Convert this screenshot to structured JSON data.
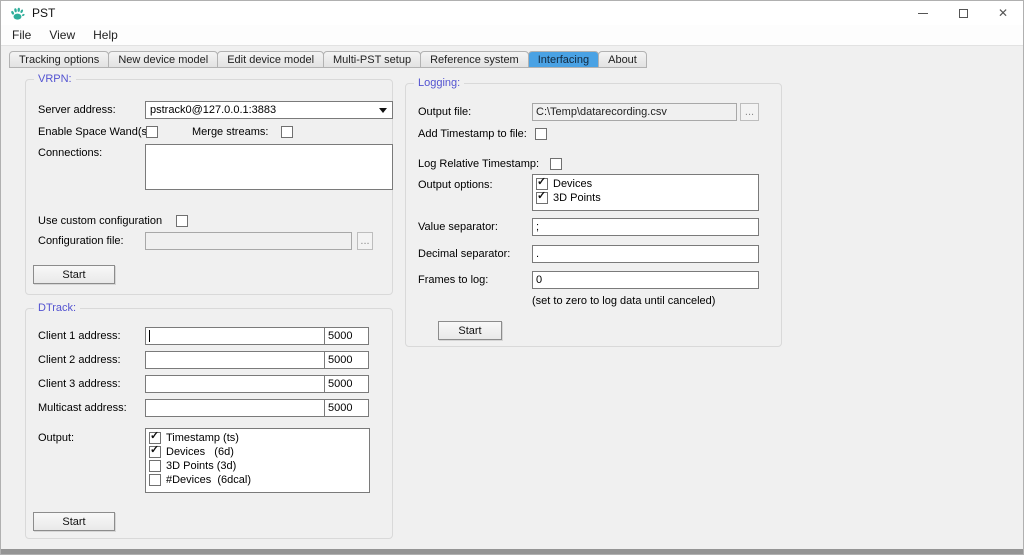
{
  "window": {
    "title": "PST",
    "controls": {
      "minimize": "minimize",
      "maximize": "maximize",
      "close": "close"
    }
  },
  "colors": {
    "tab_selected": "#4aa2e4",
    "group_title": "#5353d1",
    "app_icon_teal": "#2fae9b"
  },
  "menu": {
    "items": [
      "File",
      "View",
      "Help"
    ]
  },
  "tabs": [
    {
      "label": "Tracking options",
      "selected": false
    },
    {
      "label": "New device model",
      "selected": false
    },
    {
      "label": "Edit device model",
      "selected": false
    },
    {
      "label": "Multi-PST setup",
      "selected": false
    },
    {
      "label": "Reference system",
      "selected": false
    },
    {
      "label": "Interfacing",
      "selected": true
    },
    {
      "label": "About",
      "selected": false
    }
  ],
  "vrpn": {
    "title": "VRPN:",
    "server_address_label": "Server address:",
    "server_address_value": "pstrack0@127.0.0.1:3883",
    "enable_space_wands_label": "Enable Space Wand(s):",
    "enable_space_wands_checked": false,
    "merge_streams_label": "Merge streams:",
    "merge_streams_checked": false,
    "connections_label": "Connections:",
    "connections_value": "",
    "use_custom_configuration_label": "Use custom configuration",
    "use_custom_configuration_checked": false,
    "configuration_file_label": "Configuration file:",
    "configuration_file_value": "",
    "browse_label": "...",
    "start_label": "Start"
  },
  "dtrack": {
    "title": "DTrack:",
    "rows": [
      {
        "label": "Client 1 address:",
        "address": "",
        "port": "5000"
      },
      {
        "label": "Client 2 address:",
        "address": "",
        "port": "5000"
      },
      {
        "label": "Client 3 address:",
        "address": "",
        "port": "5000"
      },
      {
        "label": "Multicast address:",
        "address": "",
        "port": "5000"
      }
    ],
    "output_label": "Output:",
    "output_items": [
      {
        "label": "Timestamp (ts)",
        "checked": true
      },
      {
        "label": "Devices   (6d)",
        "checked": true
      },
      {
        "label": "3D Points (3d)",
        "checked": false
      },
      {
        "label": "#Devices  (6dcal)",
        "checked": false
      }
    ],
    "start_label": "Start"
  },
  "logging": {
    "title": "Logging:",
    "output_file_label": "Output file:",
    "output_file_value": "C:\\Temp\\datarecording.csv",
    "browse_label": "...",
    "add_timestamp_label": "Add Timestamp to file:",
    "add_timestamp_checked": false,
    "log_relative_timestamp_label": "Log Relative Timestamp:",
    "log_relative_timestamp_checked": false,
    "output_options_label": "Output options:",
    "output_options": [
      {
        "label": "Devices",
        "checked": true
      },
      {
        "label": "3D Points",
        "checked": true
      }
    ],
    "value_separator_label": "Value separator:",
    "value_separator_value": ";",
    "decimal_separator_label": "Decimal separator:",
    "decimal_separator_value": ".",
    "frames_to_log_label": "Frames to log:",
    "frames_to_log_value": "0",
    "frames_hint": "(set to zero to log data until canceled)",
    "start_label": "Start"
  }
}
